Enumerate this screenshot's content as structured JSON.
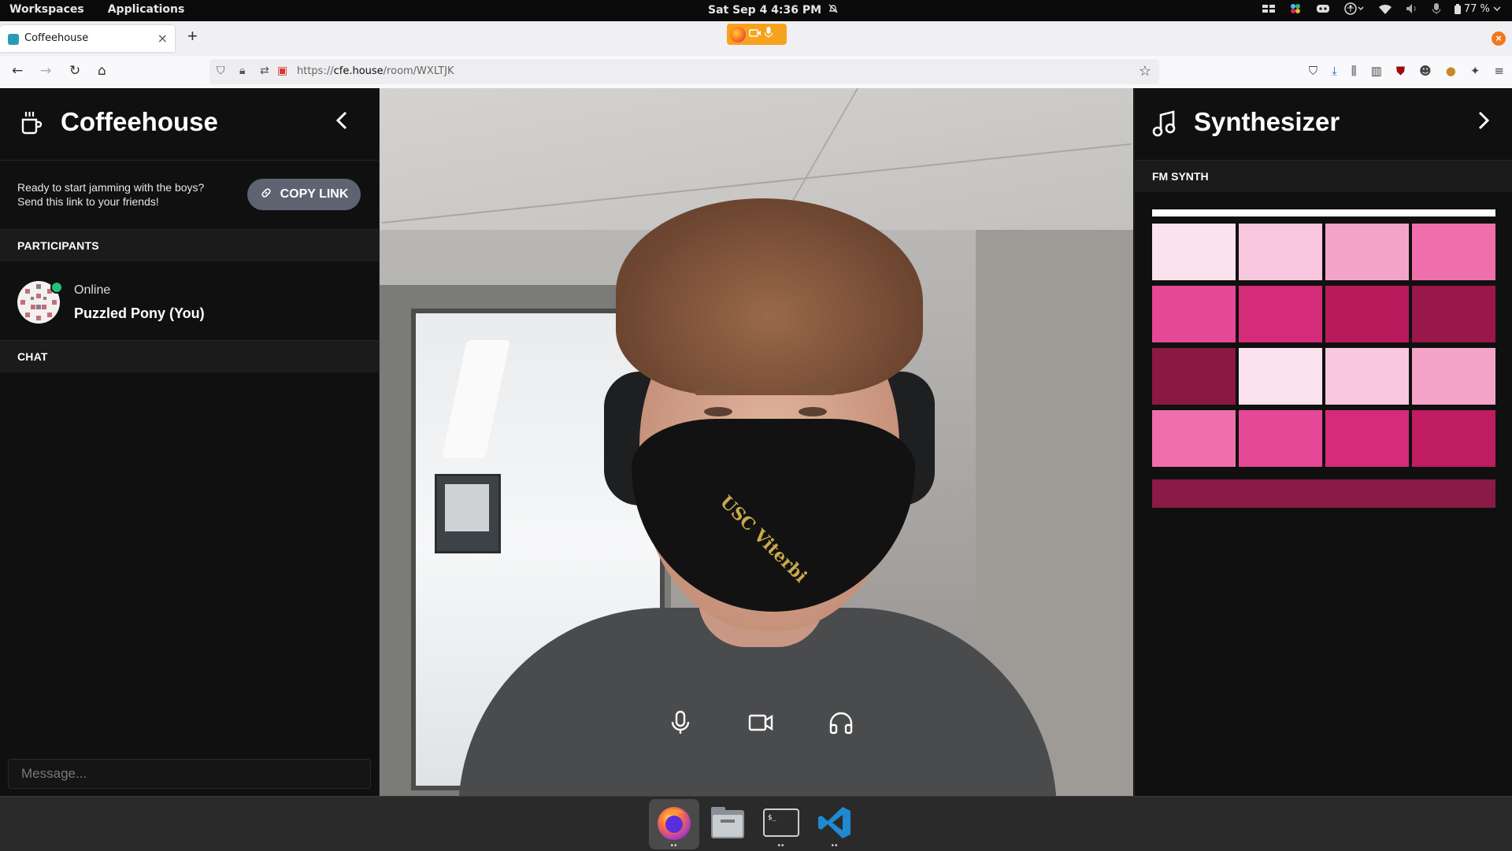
{
  "topbar": {
    "workspaces": "Workspaces",
    "applications": "Applications",
    "clock": "Sat Sep 4   4:36 PM",
    "battery": "77 %"
  },
  "browser": {
    "tab_title": "Coffeehouse",
    "url_prefix": "https://",
    "url_domain": "cfe.house",
    "url_path": "/room/WXLTJK"
  },
  "left_panel": {
    "title": "Coffeehouse",
    "invite_text": "Ready to start jamming with the boys? Send this link to your friends!",
    "copy_link_label": "COPY LINK",
    "participants_heading": "PARTICIPANTS",
    "participants": [
      {
        "status": "Online",
        "name": "Puzzled Pony (You)"
      }
    ],
    "chat_heading": "CHAT",
    "message_placeholder": "Message..."
  },
  "video": {
    "mask_text": "USC Viterbi"
  },
  "right_panel": {
    "title": "Synthesizer",
    "synth_heading": "FM SYNTH",
    "pad_colors": [
      "#fbe3ee",
      "#f9c7de",
      "#f5a4c9",
      "#ef6fac",
      "#e54896",
      "#d42c79",
      "#b81a5c",
      "#9a1749",
      "#8a1840",
      "#fbe3ee",
      "#f9c7de",
      "#f5a4c9",
      "#ef6fac",
      "#e54896",
      "#d42c79",
      "#c01c62"
    ],
    "bar_color": "#8a1a46"
  },
  "dock": {
    "apps": [
      "firefox-icon",
      "files-icon",
      "terminal-icon",
      "vscode-icon"
    ]
  }
}
